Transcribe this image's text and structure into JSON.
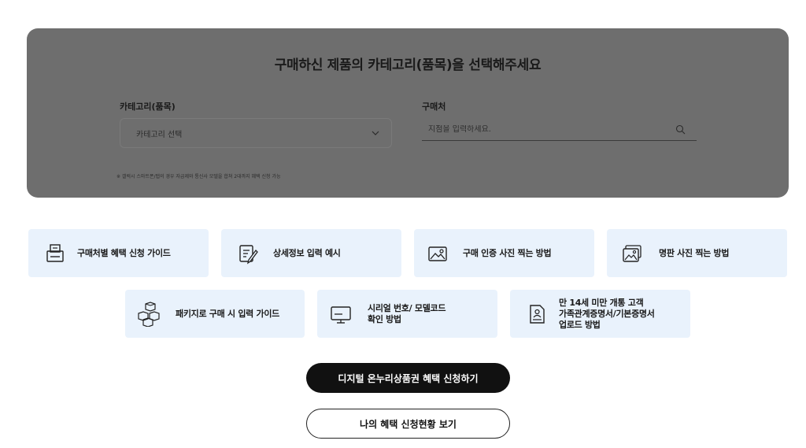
{
  "panel": {
    "title": "구매하신 제품의 카테고리(품목)을 선택해주세요",
    "category_label": "카테고리(품목)",
    "category_value": "카테고리 선택",
    "store_label": "구매처",
    "store_placeholder": "지점을 입력하세요.",
    "note": "※ 갤럭시 스마트폰/탭의 경우 자급제와 통신사 모델을 합쳐 2대까지 혜택 신청 가능"
  },
  "guides": [
    {
      "icon": "printer-icon",
      "lines": [
        "구매처별 혜택 신청 가이드"
      ]
    },
    {
      "icon": "document-pen-icon",
      "lines": [
        "상세정보 입력 예시"
      ]
    },
    {
      "icon": "image-icon",
      "lines": [
        "구매 인증 사진 찍는 방법"
      ]
    },
    {
      "icon": "images-icon",
      "lines": [
        "명판 사진 찍는 방법"
      ]
    },
    {
      "icon": "boxes-icon",
      "lines": [
        "패키지로 구매 시 입력 가이드"
      ]
    },
    {
      "icon": "monitor-icon",
      "lines": [
        "시리얼 번호/ 모델코드",
        "확인 방법"
      ]
    },
    {
      "icon": "id-document-icon",
      "lines": [
        "만 14세 미만 개통 고객",
        "가족관계증명서/기본증명서",
        "업로드 방법"
      ]
    }
  ],
  "buttons": {
    "apply": "디지털 온누리상품권 혜택 신청하기",
    "status": "나의 혜택 신청현황 보기"
  }
}
